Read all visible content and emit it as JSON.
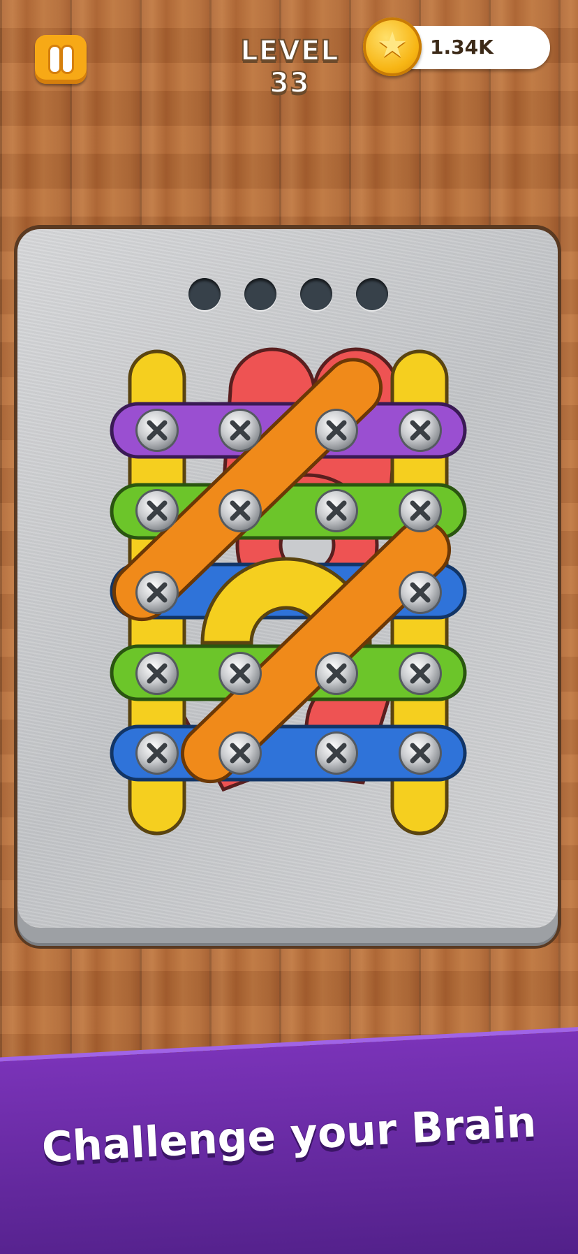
{
  "header": {
    "level_label": "LEVEL 33",
    "coins": "1.34K",
    "coin_icon": "star-coin-icon",
    "pause_icon": "pause-icon"
  },
  "board": {
    "empty_slots": 4,
    "colors": {
      "yellow": "#f5cf1f",
      "purple": "#9a4fd1",
      "green": "#6cc52a",
      "blue": "#2f73d9",
      "red": "#ee5353",
      "orange": "#f08a1a"
    }
  },
  "footer": {
    "tagline": "Challenge your Brain"
  }
}
